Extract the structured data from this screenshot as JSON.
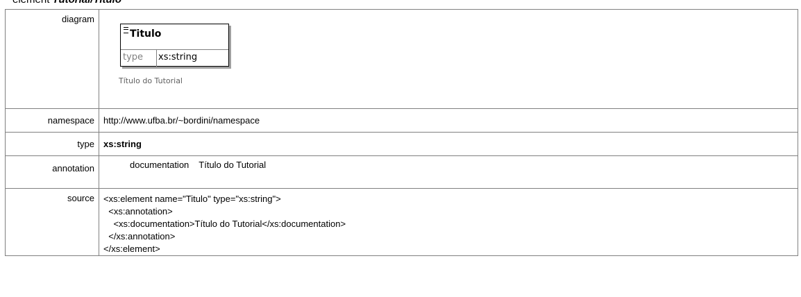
{
  "heading": {
    "prefix": "element",
    "name": "Tutorial/Titulo"
  },
  "rows": {
    "diagram": {
      "label": "diagram",
      "element_name": "Titulo",
      "type_key": "type",
      "type_value": "xs:string",
      "caption": "Título do Tutorial"
    },
    "namespace": {
      "label": "namespace",
      "value": "http://www.ufba.br/~bordini/namespace"
    },
    "type": {
      "label": "type",
      "value": "xs:string"
    },
    "annotation": {
      "label": "annotation",
      "key": "documentation",
      "value": "Título do Tutorial"
    },
    "source": {
      "label": "source",
      "code": "<xs:element name=\"Titulo\" type=\"xs:string\">\n  <xs:annotation>\n    <xs:documentation>Título do Tutorial</xs:documentation>\n  </xs:annotation>\n</xs:element>"
    }
  }
}
